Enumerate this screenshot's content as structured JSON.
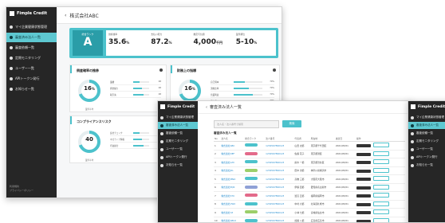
{
  "app": {
    "name": "Fimple Credit"
  },
  "sidebar_a": {
    "items": [
      {
        "label": "マイ企業健康状態管理"
      },
      {
        "label": "審査済み法人一覧"
      },
      {
        "label": "審査依頼一覧"
      },
      {
        "label": "定期モニタリング"
      },
      {
        "label": "ユーザー一覧"
      },
      {
        "label": "APIトークン発行"
      },
      {
        "label": "お知らせ一覧"
      }
    ],
    "footer": [
      "利用規約",
      "プライバシーポリシー"
    ]
  },
  "sidebar_b": {
    "items": [
      {
        "label": "マイ企業健康状態管理"
      },
      {
        "label": "審査済み法人一覧"
      },
      {
        "label": "審査依頼一覧"
      },
      {
        "label": "定期モニタリング"
      },
      {
        "label": "ユーザー一覧"
      },
      {
        "label": "APIトークン発行"
      },
      {
        "label": "お知らせ一覧"
      }
    ]
  },
  "sidebar_c": {
    "items": [
      {
        "label": "マイ企業健康状態管理"
      },
      {
        "label": "審査済み法人一覧"
      },
      {
        "label": "審査依頼一覧"
      },
      {
        "label": "定期モニタリング"
      },
      {
        "label": "ユーザー一覧"
      },
      {
        "label": "APIトークン発行"
      },
      {
        "label": "お知らせ一覧"
      }
    ]
  },
  "detail": {
    "company": "株式会社ABC",
    "rank_label": "総合ランク",
    "rank": "A",
    "metrics": [
      {
        "label": "倒産確率",
        "value": "35.6",
        "unit": "%"
      },
      {
        "label": "支払い能力",
        "value": "87.2",
        "unit": "%"
      },
      {
        "label": "推定与信額",
        "value": "4,000",
        "unit": "千円"
      },
      {
        "label": "業界順位",
        "value": "5-10",
        "unit": "%"
      }
    ],
    "cards": [
      {
        "title": "倒産確率の推移",
        "gauge": "16",
        "gauge_unit": "%",
        "gauge_sub": "業界平均",
        "rows": [
          {
            "k": "業績",
            "v": "48"
          },
          {
            "k": "資金繰り",
            "v": "48"
          },
          {
            "k": "取引先",
            "v": "48"
          }
        ]
      },
      {
        "title": "財務上の指標",
        "gauge": "16",
        "gauge_unit": "%",
        "gauge_sub": "業界平均",
        "rows": [
          {
            "k": "自己資本",
            "v": "70%"
          },
          {
            "k": "流動比率",
            "v": "70%"
          },
          {
            "k": "営業利益",
            "v": "70%"
          },
          {
            "k": "売上高",
            "v": "70%"
          }
        ]
      },
      {
        "title": "コンプライアンスリスク",
        "gauge": "40",
        "gauge_unit": "",
        "gauge_sub": "業界平均",
        "rows": [
          {
            "k": "反社チェック",
            "v": "40"
          },
          {
            "k": "ネガティブ情報",
            "v": "40"
          },
          {
            "k": "行政処分",
            "v": "40"
          }
        ]
      }
    ]
  },
  "list": {
    "page_title": "審査済み法人一覧",
    "search_placeholder": "法人名・法人番号で検索",
    "search_button": "検索",
    "list_title": "審査済み法人一覧",
    "columns": [
      "No",
      "法人名",
      "総合ランク",
      "法人番号",
      "代表者",
      "所在地",
      "審査日",
      "操作"
    ],
    "rows": [
      {
        "no": "1",
        "name": "株式会社ABC",
        "rank_color": "#4cc2cc",
        "number": "1234567890123",
        "rep": "山田 太郎",
        "addr": "東京都千代田区",
        "date": "2021/05/01"
      },
      {
        "no": "2",
        "name": "株式会社DEF",
        "rank_color": "#e36a8a",
        "number": "1234567890123",
        "rep": "佐藤 花子",
        "addr": "東京都港区",
        "date": "2021/05/01"
      },
      {
        "no": "3",
        "name": "株式会社GHI",
        "rank_color": "#4cc2cc",
        "number": "1234567890123",
        "rep": "鈴木 一郎",
        "addr": "東京都渋谷区",
        "date": "2021/05/01"
      },
      {
        "no": "4",
        "name": "株式会社JKL",
        "rank_color": "#9ccf6a",
        "number": "1234567890123",
        "rep": "田中 次郎",
        "addr": "神奈川県横浜市",
        "date": "2021/05/01"
      },
      {
        "no": "5",
        "name": "株式会社MNO",
        "rank_color": "#4cc2cc",
        "number": "1234567890123",
        "rep": "高橋 三郎",
        "addr": "大阪府大阪市",
        "date": "2021/05/01"
      },
      {
        "no": "6",
        "name": "株式会社PQR",
        "rank_color": "#8fa1d6",
        "number": "1234567890123",
        "rep": "伊藤 四郎",
        "addr": "愛知県名古屋市",
        "date": "2021/05/01"
      },
      {
        "no": "7",
        "name": "株式会社STU",
        "rank_color": "#e36a8a",
        "number": "1234567890123",
        "rep": "渡辺 五郎",
        "addr": "福岡県福岡市",
        "date": "2021/05/01"
      },
      {
        "no": "8",
        "name": "株式会社VWX",
        "rank_color": "#4cc2cc",
        "number": "1234567890123",
        "rep": "中村 六郎",
        "addr": "北海道札幌市",
        "date": "2021/05/01"
      },
      {
        "no": "9",
        "name": "株式会社YZ",
        "rank_color": "#9ccf6a",
        "number": "1234567890123",
        "rep": "小林 七郎",
        "addr": "宮城県仙台市",
        "date": "2021/05/01"
      },
      {
        "no": "10",
        "name": "株式会社ABC2",
        "rank_color": "#4cc2cc",
        "number": "1234567890123",
        "rep": "加藤 八郎",
        "addr": "広島県広島市",
        "date": "2021/05/01"
      }
    ]
  },
  "colors": {
    "accent": "#4cc2cc",
    "sidebar": "#262626"
  }
}
